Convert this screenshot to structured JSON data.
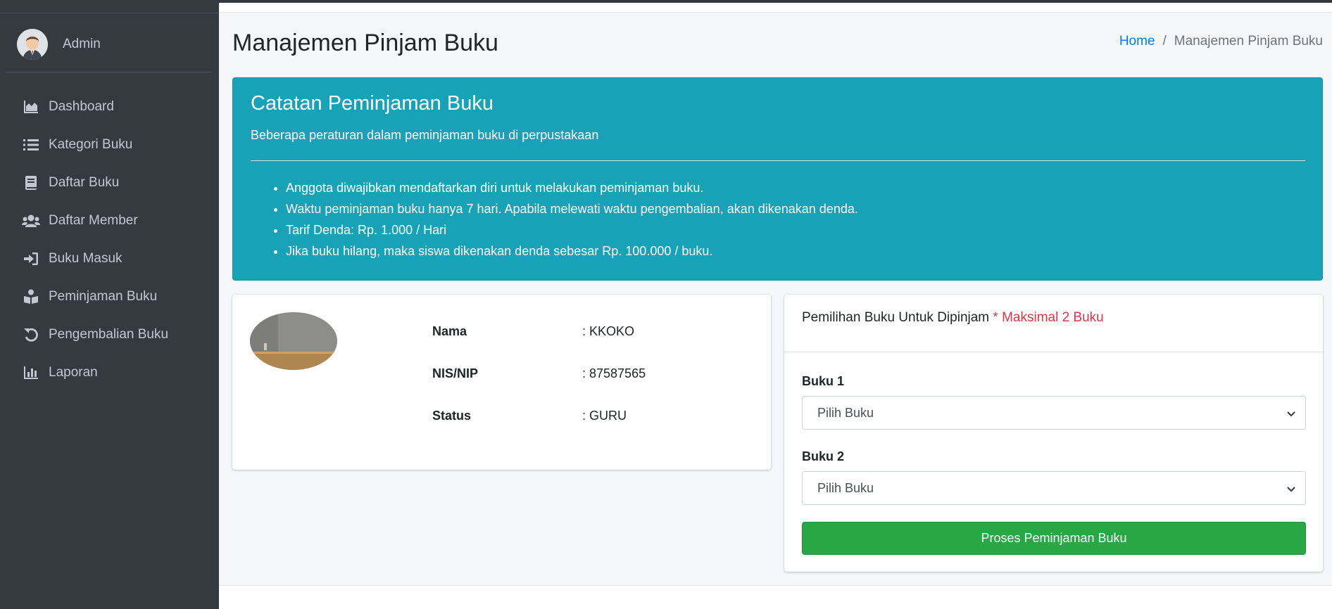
{
  "user": {
    "name": "Admin"
  },
  "sidebar": {
    "items": [
      {
        "label": "Dashboard",
        "icon": "chart-area-icon"
      },
      {
        "label": "Kategori Buku",
        "icon": "list-icon"
      },
      {
        "label": "Daftar Buku",
        "icon": "book-icon"
      },
      {
        "label": "Daftar Member",
        "icon": "users-icon"
      },
      {
        "label": "Buku Masuk",
        "icon": "sign-in-icon"
      },
      {
        "label": "Peminjaman Buku",
        "icon": "book-reader-icon"
      },
      {
        "label": "Pengembalian Buku",
        "icon": "undo-icon"
      },
      {
        "label": "Laporan",
        "icon": "bar-chart-icon"
      }
    ]
  },
  "header": {
    "title": "Manajemen Pinjam Buku",
    "breadcrumb": {
      "home": "Home",
      "separator": "/",
      "current": "Manajemen Pinjam Buku"
    }
  },
  "callout": {
    "title": "Catatan Peminjaman Buku",
    "subtitle": "Beberapa peraturan dalam peminjaman buku di perpustakaan",
    "rules": [
      "Anggota diwajibkan mendaftarkan diri untuk melakukan peminjaman buku.",
      "Waktu peminjaman buku hanya 7 hari. Apabila melewati waktu pengembalian, akan dikenakan denda.",
      "Tarif Denda: Rp. 1.000 / Hari",
      "Jika buku hilang, maka siswa dikenakan denda sebesar Rp. 100.000 / buku."
    ]
  },
  "member": {
    "nama_label": "Nama",
    "nama_value": ": KKOKO",
    "nis_label": "NIS/NIP",
    "nis_value": ": 87587565",
    "status_label": "Status",
    "status_value": ": GURU"
  },
  "selection": {
    "header": "Pemilihan Buku Untuk Dipinjam",
    "required": "* Maksimal 2 Buku",
    "buku1_label": "Buku 1",
    "buku1_value": "Pilih Buku",
    "buku2_label": "Buku 2",
    "buku2_value": "Pilih Buku",
    "submit_label": "Proses Peminjaman Buku"
  },
  "colors": {
    "sidebar": "#343a40",
    "callout": "#17a2b8",
    "success": "#28a745",
    "danger": "#dc3545",
    "link": "#007bff"
  }
}
